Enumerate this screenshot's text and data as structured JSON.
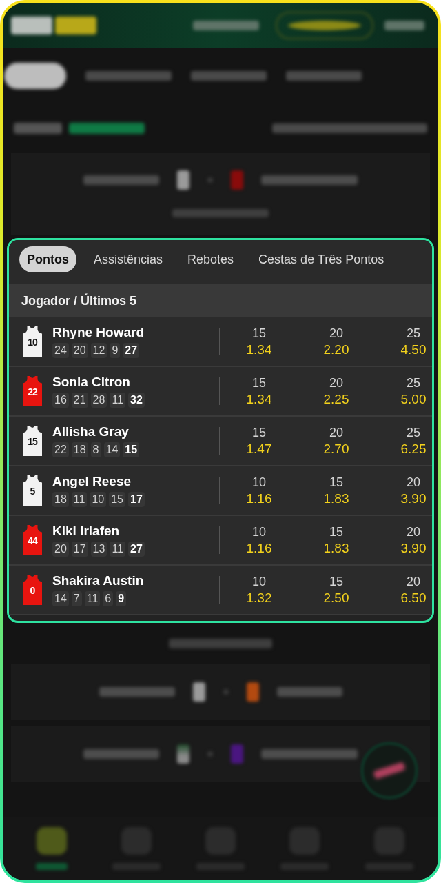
{
  "blurred_background": {
    "tabs": [
      {
        "selected": true
      },
      {
        "selected": false
      },
      {
        "selected": false
      },
      {
        "selected": false
      }
    ],
    "bottom_nav": [
      {
        "selected": true
      },
      {
        "selected": false
      },
      {
        "selected": false
      },
      {
        "selected": false
      },
      {
        "selected": false
      }
    ]
  },
  "tabs": [
    {
      "label": "Pontos",
      "selected": true
    },
    {
      "label": "Assistências",
      "selected": false
    },
    {
      "label": "Rebotes",
      "selected": false
    },
    {
      "label": "Cestas de Três Pontos",
      "selected": false
    }
  ],
  "table": {
    "header": "Jogador / Últimos 5",
    "rows": [
      {
        "player": "Rhyne Howard",
        "jersey": {
          "number": "10",
          "color": "#f2f2f2"
        },
        "last_5": [
          "24",
          "20",
          "12",
          "9",
          "27"
        ],
        "markets": [
          {
            "line": "15",
            "odds": "1.34"
          },
          {
            "line": "20",
            "odds": "2.20"
          },
          {
            "line": "25",
            "odds": "4.50"
          }
        ]
      },
      {
        "player": "Sonia Citron",
        "jersey": {
          "number": "22",
          "color": "#e8140f"
        },
        "last_5": [
          "16",
          "21",
          "28",
          "11",
          "32"
        ],
        "markets": [
          {
            "line": "15",
            "odds": "1.34"
          },
          {
            "line": "20",
            "odds": "2.25"
          },
          {
            "line": "25",
            "odds": "5.00"
          }
        ]
      },
      {
        "player": "Allisha Gray",
        "jersey": {
          "number": "15",
          "color": "#f2f2f2"
        },
        "last_5": [
          "22",
          "18",
          "8",
          "14",
          "15"
        ],
        "markets": [
          {
            "line": "15",
            "odds": "1.47"
          },
          {
            "line": "20",
            "odds": "2.70"
          },
          {
            "line": "25",
            "odds": "6.25"
          }
        ]
      },
      {
        "player": "Angel Reese",
        "jersey": {
          "number": "5",
          "color": "#f2f2f2"
        },
        "last_5": [
          "18",
          "11",
          "10",
          "15",
          "17"
        ],
        "markets": [
          {
            "line": "10",
            "odds": "1.16"
          },
          {
            "line": "15",
            "odds": "1.83"
          },
          {
            "line": "20",
            "odds": "3.90"
          }
        ]
      },
      {
        "player": "Kiki Iriafen",
        "jersey": {
          "number": "44",
          "color": "#e8140f"
        },
        "last_5": [
          "20",
          "17",
          "13",
          "11",
          "27"
        ],
        "markets": [
          {
            "line": "10",
            "odds": "1.16"
          },
          {
            "line": "15",
            "odds": "1.83"
          },
          {
            "line": "20",
            "odds": "3.90"
          }
        ]
      },
      {
        "player": "Shakira Austin",
        "jersey": {
          "number": "0",
          "color": "#e8140f"
        },
        "last_5": [
          "14",
          "7",
          "11",
          "6",
          "9"
        ],
        "markets": [
          {
            "line": "10",
            "odds": "1.32"
          },
          {
            "line": "15",
            "odds": "2.50"
          },
          {
            "line": "20",
            "odds": "6.50"
          }
        ]
      }
    ]
  }
}
